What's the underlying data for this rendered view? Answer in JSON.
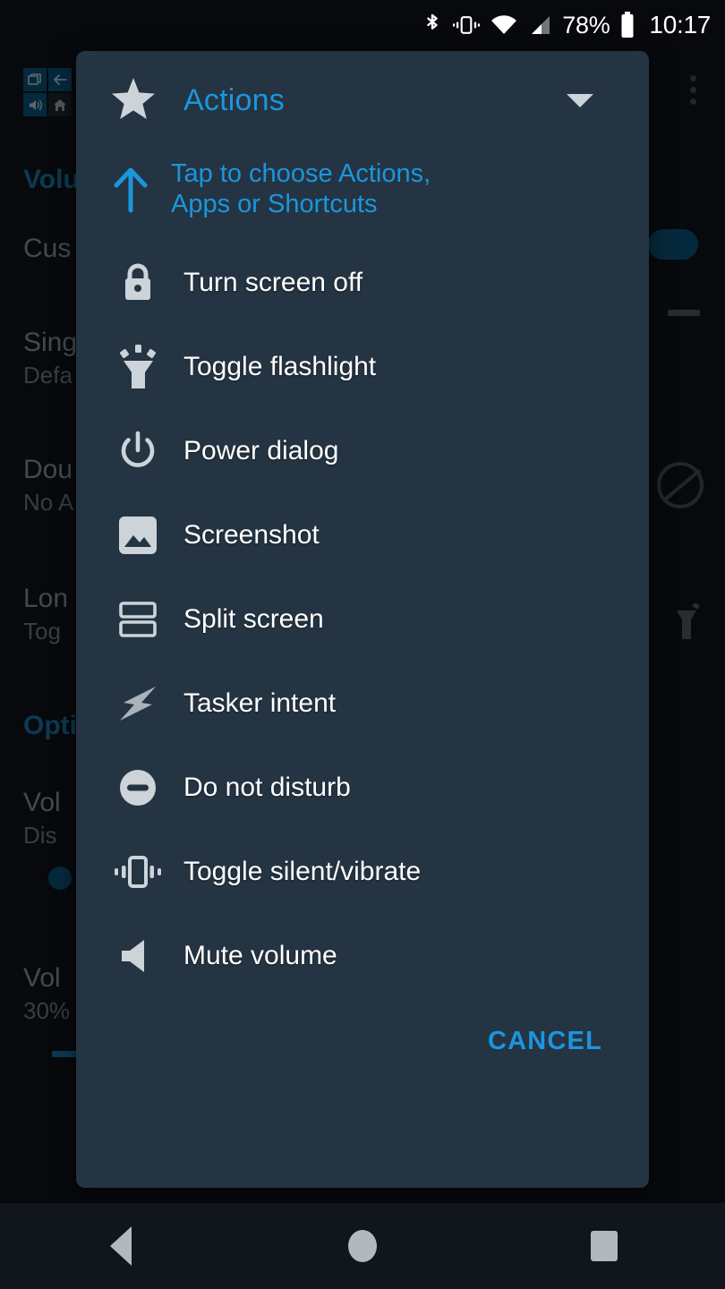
{
  "statusbar": {
    "icons": [
      "bluetooth-icon",
      "vibrate-icon",
      "wifi-icon",
      "signal-icon"
    ],
    "battery_percent": "78%",
    "battery_icon": "battery-icon",
    "clock": "10:17"
  },
  "background_app": {
    "quick_icons": [
      "recents-icon",
      "back-icon",
      "volume-icon",
      "home-icon"
    ],
    "overflow_icon": "overflow-menu-icon",
    "rows": [
      {
        "title": "Volu",
        "subtitle": ""
      },
      {
        "title": "Cus",
        "subtitle": ""
      },
      {
        "title": "Sing",
        "subtitle": "Defa"
      },
      {
        "title": "Dou",
        "subtitle": "No A"
      },
      {
        "title": "Lon",
        "subtitle": "Tog"
      },
      {
        "title": "Opti",
        "subtitle": ""
      },
      {
        "title": "Vol",
        "subtitle": "Dis"
      },
      {
        "title": "Vol",
        "subtitle": "30%"
      }
    ]
  },
  "dialog": {
    "title": "Actions",
    "title_icon": "star-icon",
    "dropdown_icon": "caret-down-icon",
    "chooser": {
      "icon": "arrow-up-icon",
      "text": "Tap to choose Actions, Apps or Shortcuts"
    },
    "items": [
      {
        "label": "Turn screen off",
        "icon": "lock-icon"
      },
      {
        "label": "Toggle flashlight",
        "icon": "flashlight-icon"
      },
      {
        "label": "Power dialog",
        "icon": "power-icon"
      },
      {
        "label": "Screenshot",
        "icon": "image-icon"
      },
      {
        "label": "Split screen",
        "icon": "split-screen-icon"
      },
      {
        "label": "Tasker intent",
        "icon": "lightning-bolt-icon"
      },
      {
        "label": "Do not disturb",
        "icon": "do-not-disturb-icon"
      },
      {
        "label": "Toggle silent/vibrate",
        "icon": "vibrate-icon"
      },
      {
        "label": "Mute volume",
        "icon": "speaker-icon"
      }
    ],
    "cancel_label": "CANCEL"
  },
  "navbar": {
    "back": "back-nav-icon",
    "home": "home-nav-icon",
    "recents": "recents-nav-icon"
  },
  "colors": {
    "accent": "#1b96dd",
    "dialog_bg": "#243442",
    "screen_bg": "#11161d",
    "icon_gray": "#ccd3d9"
  }
}
